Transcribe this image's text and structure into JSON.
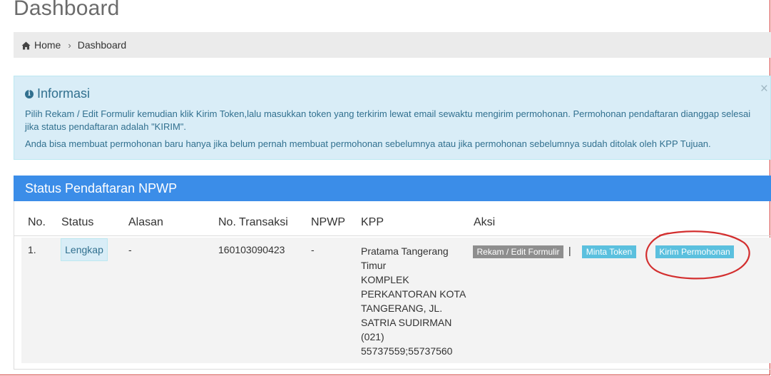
{
  "page": {
    "title": "Dashboard"
  },
  "breadcrumb": {
    "home_icon": "home-icon",
    "items": [
      "Home",
      "Dashboard"
    ],
    "separator": "›"
  },
  "alert": {
    "icon": "info-icon",
    "heading": "Informasi",
    "close": "×",
    "paragraph1": "Pilih Rekam / Edit Formulir kemudian klik Kirim Token,lalu masukkan token yang terkirim lewat email sewaktu mengirim permohonan. Permohonan pendaftaran dianggap selesai jika status pendaftaran adalah \"KIRIM\".",
    "paragraph2": "Anda bisa membuat permohonan baru hanya jika belum pernah membuat permohonan sebelumnya atau jika permohonan sebelumnya sudah ditolak oleh KPP Tujuan."
  },
  "panel": {
    "title": "Status Pendaftaran NPWP",
    "columns": [
      "No.",
      "Status",
      "Alasan",
      "No. Transaksi",
      "NPWP",
      "KPP",
      "Aksi"
    ],
    "rows": [
      {
        "no": "1.",
        "status": "Lengkap",
        "alasan": "-",
        "no_transaksi": "160103090423",
        "npwp": "-",
        "kpp_lines": [
          "Pratama Tangerang",
          "Timur",
          "KOMPLEK",
          "PERKANTORAN KOTA",
          "TANGERANG, JL.",
          "SATRIA SUDIRMAN",
          "(021)",
          "55737559;55737560"
        ],
        "actions": {
          "rekam": "Rekam / Edit Formulir",
          "separator": "|",
          "token": "Minta Token",
          "kirim": "Kirim Permohonan"
        }
      }
    ]
  },
  "colors": {
    "panel_heading": "#3b8de8",
    "alert_bg": "#d9edf7",
    "alert_text": "#31708f",
    "btn_gray": "#8e8e8e",
    "btn_info": "#5bc0de",
    "annotation": "#d32f2f"
  }
}
